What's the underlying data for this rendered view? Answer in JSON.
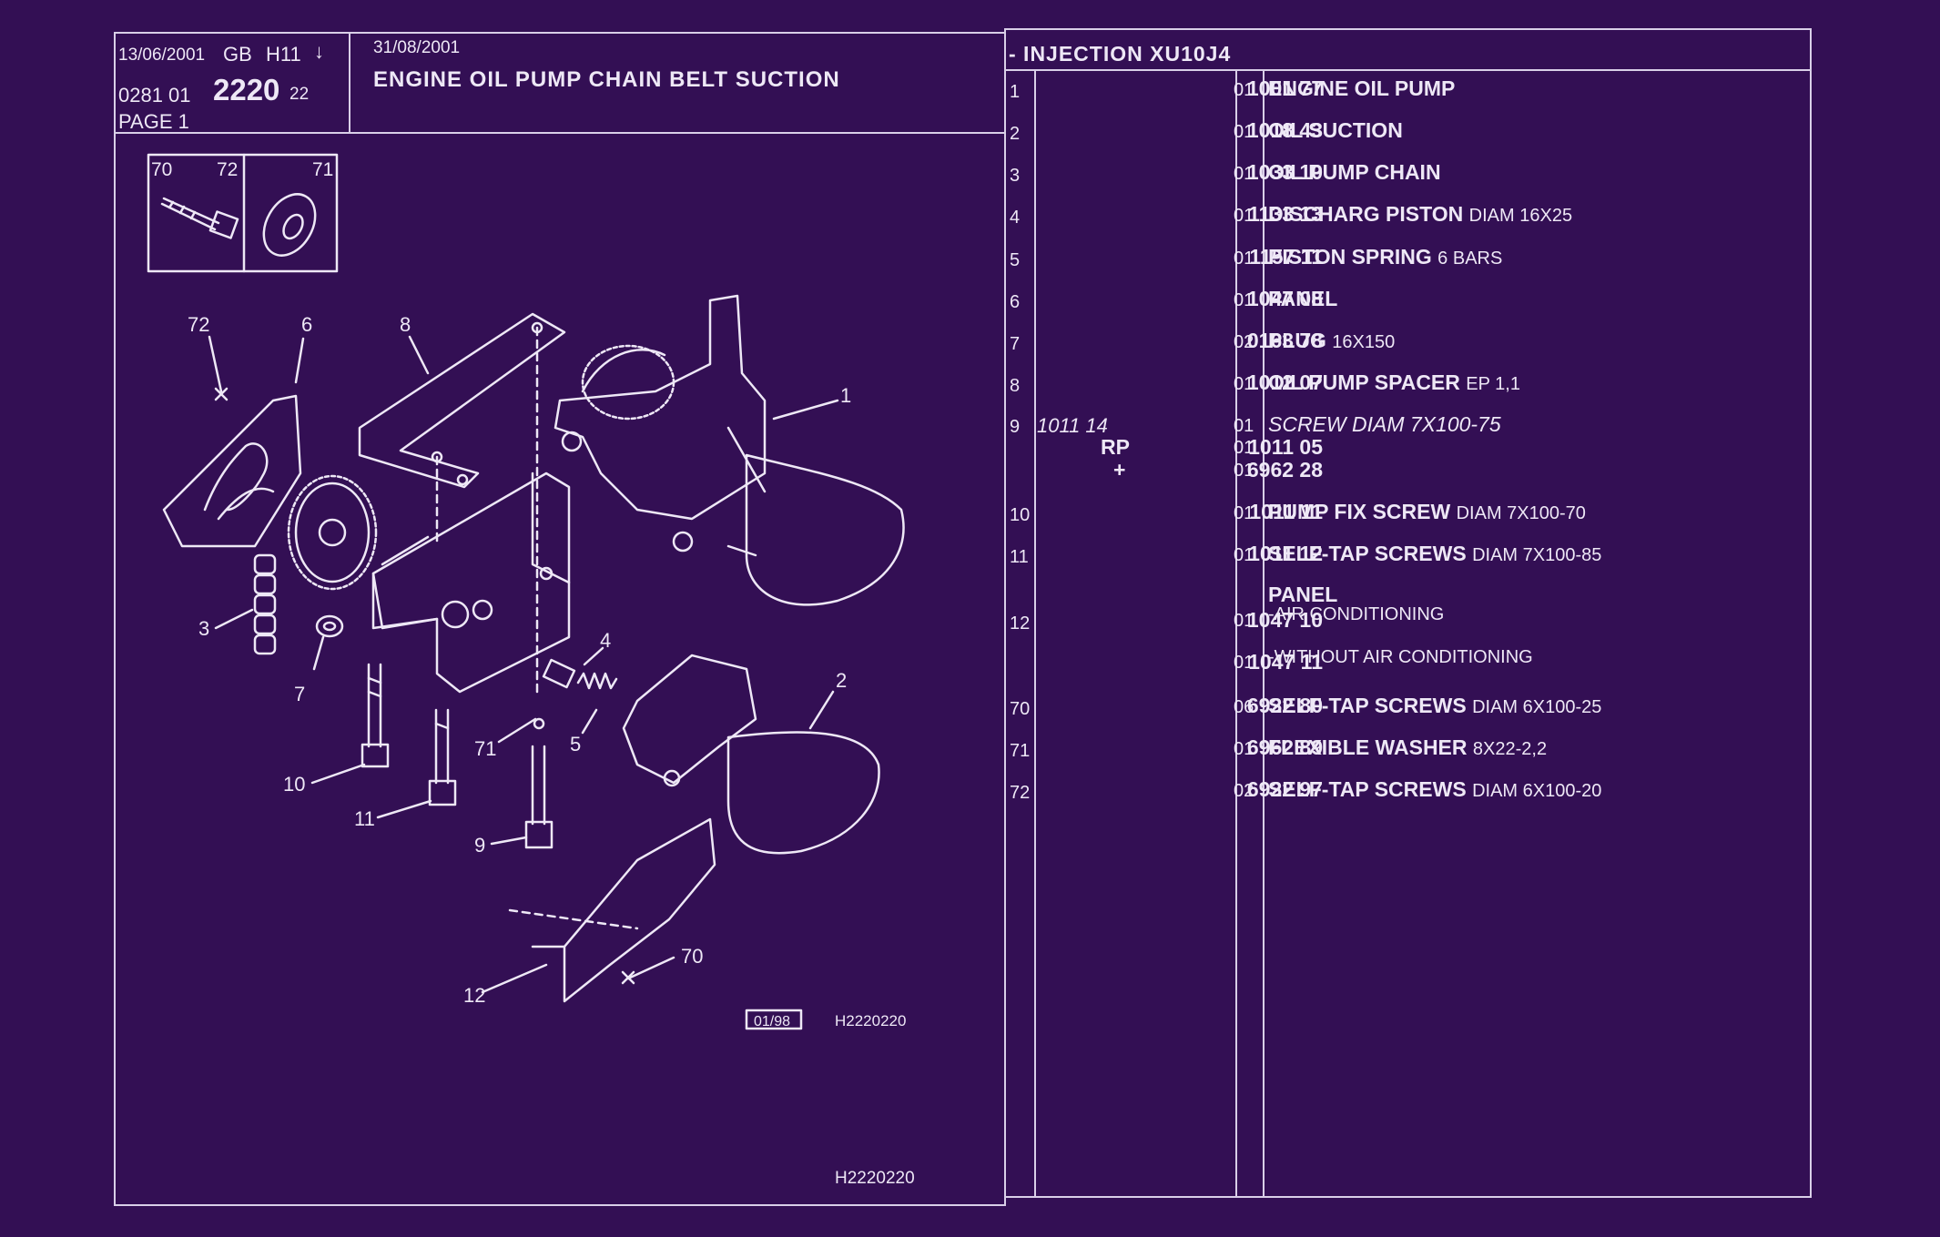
{
  "header": {
    "date1": "13/06/2001",
    "code_gb": "GB",
    "code_h": "H11",
    "arrow": "↓",
    "ref_prefix": "0281  01",
    "ref_main": "2220",
    "ref_suffix": "22",
    "page": "PAGE  1",
    "date2": "31/08/2001",
    "title": "ENGINE OIL PUMP CHAIN BELT SUCTION",
    "section": "- INJECTION XU10J4"
  },
  "diagram": {
    "inset_labels": [
      "70",
      "72",
      "71"
    ],
    "callouts": [
      "1",
      "2",
      "3",
      "4",
      "5",
      "6",
      "7",
      "8",
      "9",
      "10",
      "11",
      "12",
      "70",
      "71",
      "72"
    ],
    "stamp": "01/98",
    "code_small": "H2220220",
    "code_bottom": "H2220220"
  },
  "parts": [
    {
      "idx": "1",
      "ref": "1001 77",
      "qty": "01",
      "name": "ENGINE OIL PUMP",
      "extra": ""
    },
    {
      "idx": "2",
      "ref": "1018 43",
      "qty": "01",
      "name": "OIL SUCTION",
      "extra": ""
    },
    {
      "idx": "3",
      "ref": "1033 10",
      "qty": "01",
      "name": "OIL PUMP CHAIN",
      "extra": ""
    },
    {
      "idx": "4",
      "ref": "1133 13",
      "qty": "01",
      "name": "DISCHARG PISTON",
      "extra": "DIAM 16X25"
    },
    {
      "idx": "5",
      "ref": "1157 11",
      "qty": "01",
      "name": "PISTON SPRING",
      "extra": "6 BARS"
    },
    {
      "idx": "6",
      "ref": "1047 08",
      "qty": "01",
      "name": "PANEL",
      "extra": ""
    },
    {
      "idx": "7",
      "ref": "0163 78",
      "qty": "02",
      "name": "PLUG",
      "extra": "16X150"
    },
    {
      "idx": "8",
      "ref": "1012 07",
      "qty": "01",
      "name": "OIL PUMP SPACER",
      "extra": "EP 1,1"
    }
  ],
  "part9": {
    "idx": "9",
    "ref_it": "1011 14",
    "qty": "01",
    "name": "SCREW DIAM 7X100-75",
    "rp_label": "RP",
    "rp_ref": "1011 05",
    "rp_qty": "01",
    "plus_label": "+",
    "plus_ref": "6962 28",
    "plus_qty": "01"
  },
  "parts2": [
    {
      "idx": "10",
      "ref": "1011 11",
      "qty": "01",
      "name": "PUMP FIX SCREW",
      "extra": "DIAM 7X100-70"
    },
    {
      "idx": "11",
      "ref": "1011 12",
      "qty": "01",
      "name": "SELF-TAP SCREWS",
      "extra": "DIAM 7X100-85"
    }
  ],
  "part12": {
    "idx": "12",
    "heading": "PANEL",
    "ref_a": "1047 10",
    "qty_a": "01",
    "desc_a": "-AIR CONDITIONING",
    "ref_b": "1047 11",
    "qty_b": "01",
    "desc_b": "-WITHOUT AIR CONDITIONING"
  },
  "parts3": [
    {
      "idx": "70",
      "ref": "6922 80",
      "qty": "06",
      "name": "SELF-TAP SCREWS",
      "extra": "DIAM 6X100-25"
    },
    {
      "idx": "71",
      "ref": "6962 89",
      "qty": "01",
      "name": "FLEXIBLE WASHER",
      "extra": "8X22-2,2"
    },
    {
      "idx": "72",
      "ref": "6922 97",
      "qty": "02",
      "name": "SELF-TAP SCREWS",
      "extra": "DIAM 6X100-20"
    }
  ]
}
